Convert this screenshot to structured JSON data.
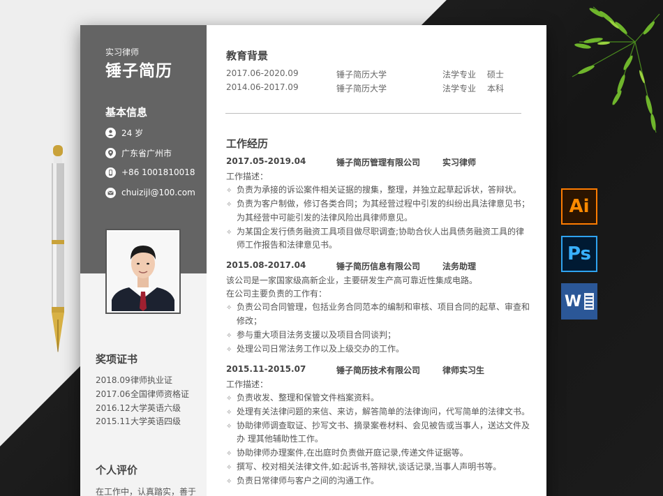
{
  "sidebar": {
    "role": "实习律师",
    "name": "锤子简历",
    "basic_title": "基本信息",
    "info": [
      {
        "icon": "person-icon",
        "text": "24 岁"
      },
      {
        "icon": "location-icon",
        "text": "广东省广州市"
      },
      {
        "icon": "phone-icon",
        "text": "+86 1001810018"
      },
      {
        "icon": "mail-icon",
        "text": "chuizijl@100.com"
      }
    ],
    "awards_title": "奖项证书",
    "awards": [
      {
        "date": "2018.09",
        "name": "律师执业证"
      },
      {
        "date": "2017.06",
        "name": "全国律师资格证"
      },
      {
        "date": "2016.12",
        "name": "大学英语六级"
      },
      {
        "date": "2015.11",
        "name": "大学英语四级"
      }
    ],
    "eval_title": "个人评价",
    "eval_text": "在工作中，认真踏实，善于"
  },
  "education": {
    "title": "教育背景",
    "rows": [
      {
        "period": "2017.06-2020.09",
        "school": "锤子简历大学",
        "major": "法学专业",
        "degree": "硕士"
      },
      {
        "period": "2014.06-2017.09",
        "school": "锤子简历大学",
        "major": "法学专业",
        "degree": "本科"
      }
    ]
  },
  "work": {
    "title": "工作经历",
    "jobs": [
      {
        "period": "2017.05-2019.04",
        "company": "锤子简历管理有限公司",
        "position": "实习律师",
        "intro": [
          "工作描述："
        ],
        "bullets": [
          [
            "负责为承接的诉讼案件相关证据的搜集，整理，并独立起草起诉状，答辩状。"
          ],
          [
            "负责为客户制做，修订各类合同；为其经营过程中引发的纠纷出具法律意见书；",
            "为其经营中可能引发的法律风险出具律师意见。"
          ],
          [
            "为某国企发行债务融资工具项目做尽职调查;协助合伙人出具债务融资工具的律",
            "师工作报告和法律意见书。"
          ]
        ]
      },
      {
        "period": "2015.08-2017.04",
        "company": "锤子简历信息有限公司",
        "position": "法务助理",
        "intro": [
          "该公司是一家国家级高新企业，主要研发生产高可靠近性集成电路。",
          "在公司主要负责的工作有："
        ],
        "bullets": [
          [
            "负责公司合同管理，包括业务合同范本的编制和审核、项目合同的起草、审查和",
            "修改；"
          ],
          [
            "参与重大项目法务支援以及项目合同谈判；"
          ],
          [
            "处理公司日常法务工作以及上级交办的工作。"
          ]
        ]
      },
      {
        "period": "2015.11-2015.07",
        "company": "锤子简历技术有限公司",
        "position": "律师实习生",
        "intro": [
          "工作描述："
        ],
        "bullets": [
          [
            "负责收发、整理和保管文件档案资料。"
          ],
          [
            "处理有关法律问题的来信、来访，解答简单的法律询问，代写简单的法律文书。"
          ],
          [
            "协助律师调查取证、抄写文书、摘录案卷材料、会见被告或当事人，送达文件及",
            "办  理其他辅助性工作。"
          ],
          [
            "协助律师办理案件,在出庭时负责做开庭记录,传递文件证据等。"
          ],
          [
            "撰写、校对相关法律文件,如:起诉书,答辩状,谈话记录,当事人声明书等。"
          ],
          [
            "负责日常律师与客户之间的沟通工作。"
          ]
        ]
      }
    ]
  },
  "badges": {
    "ai": "Ai",
    "ps": "Ps",
    "word": "W"
  },
  "bullet_glyph": "✧"
}
